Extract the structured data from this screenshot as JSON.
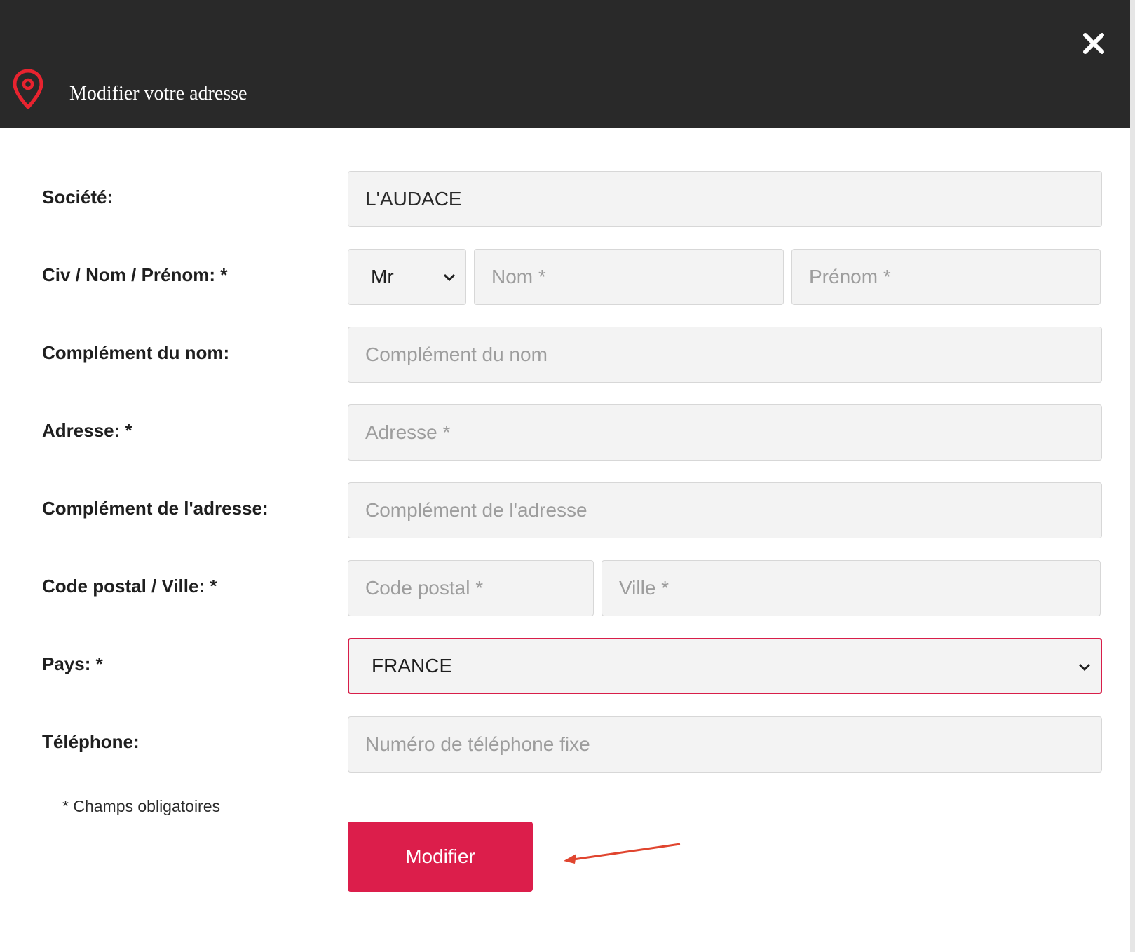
{
  "dialog": {
    "title": "Modifier votre adresse",
    "icon": "map-pin-icon",
    "close_icon": "close-icon"
  },
  "form": {
    "societe": {
      "label": "Société:",
      "value": "L'AUDACE"
    },
    "civ_nom_prenom": {
      "label": "Civ / Nom / Prénom: *",
      "civilite": "Mr",
      "nom_placeholder": "Nom *",
      "prenom_placeholder": "Prénom *"
    },
    "complement_nom": {
      "label": "Complément du nom:",
      "placeholder": "Complément du nom"
    },
    "adresse": {
      "label": "Adresse: *",
      "placeholder": "Adresse *"
    },
    "complement_adresse": {
      "label": "Complément de l'adresse:",
      "placeholder": "Complément de l'adresse"
    },
    "code_postal_ville": {
      "label": "Code postal / Ville: *",
      "code_placeholder": "Code postal *",
      "ville_placeholder": "Ville *"
    },
    "pays": {
      "label": "Pays: *",
      "value": "FRANCE"
    },
    "telephone": {
      "label": "Téléphone:",
      "placeholder": "Numéro de téléphone fixe"
    },
    "required_note": "* Champs obligatoires",
    "submit_label": "Modifier"
  },
  "colors": {
    "header_bg": "#292929",
    "accent": "#dc1e4b",
    "pin": "#e8232f",
    "annotation_arrow": "#e0452f"
  }
}
